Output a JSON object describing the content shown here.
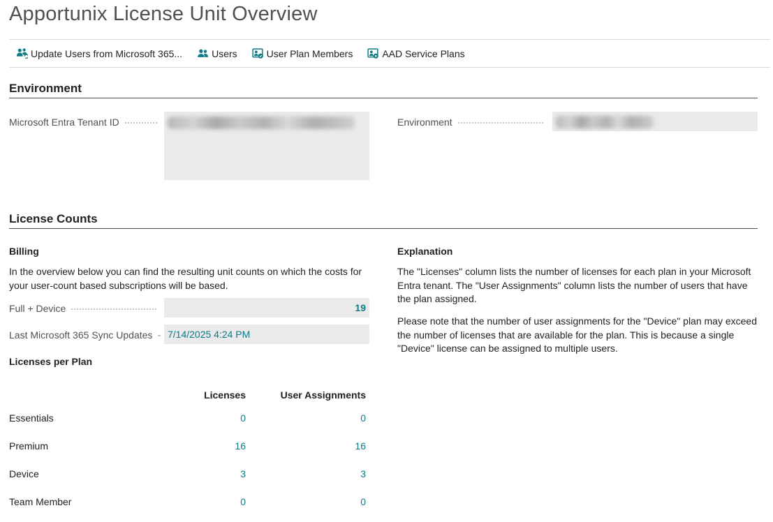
{
  "page": {
    "title": "Apportunix License Unit Overview"
  },
  "actions": [
    {
      "label": "Update Users from Microsoft 365...",
      "icon": "users-refresh-icon"
    },
    {
      "label": "Users",
      "icon": "users-icon"
    },
    {
      "label": "User Plan Members",
      "icon": "user-plan-icon"
    },
    {
      "label": "AAD Service Plans",
      "icon": "service-plan-icon"
    }
  ],
  "environment": {
    "section_title": "Environment",
    "tenant_label": "Microsoft Entra Tenant ID",
    "tenant_value": "",
    "environment_label": "Environment",
    "environment_value": ""
  },
  "license_counts": {
    "section_title": "License Counts",
    "billing": {
      "title": "Billing",
      "description": "In the overview below you can find the resulting unit counts on which the costs for your user-count based subscriptions will be based.",
      "full_device_label": "Full + Device",
      "full_device_value": "19",
      "last_sync_label": "Last Microsoft 365 Sync Updates",
      "last_sync_value": "7/14/2025 4:24 PM"
    },
    "explanation": {
      "title": "Explanation",
      "paragraph1": "The \"Licenses\" column lists the number of licenses for each plan in your Microsoft Entra tenant. The \"User Assignments\" column lists the number of users that have the plan assigned.",
      "paragraph2": "Please note that the number of user assignments for the \"Device\" plan may exceed the number of licenses that are available for the plan. This is because a single \"Device\" license can be assigned to multiple users."
    },
    "plans": {
      "title": "Licenses per Plan",
      "columns": [
        "Licenses",
        "User Assignments"
      ],
      "rows": [
        {
          "name": "Essentials",
          "licenses": "0",
          "assignments": "0"
        },
        {
          "name": "Premium",
          "licenses": "16",
          "assignments": "16"
        },
        {
          "name": "Device",
          "licenses": "3",
          "assignments": "3"
        },
        {
          "name": "Team Member",
          "licenses": "0",
          "assignments": "0"
        }
      ]
    }
  },
  "colors": {
    "accent": "#0e7a85",
    "field_bg": "#eaeaea",
    "rule": "#4e4e4e"
  }
}
